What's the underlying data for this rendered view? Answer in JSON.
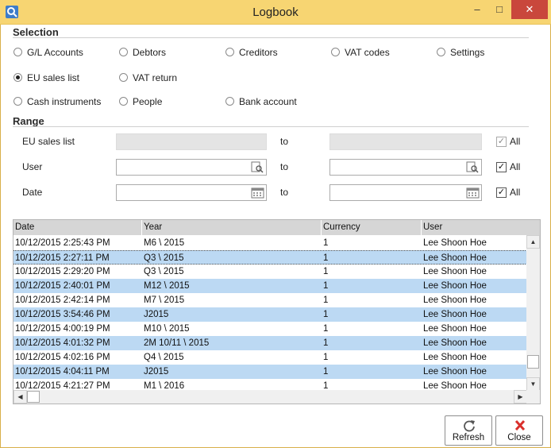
{
  "window": {
    "title": "Logbook",
    "minimize_glyph": "‒",
    "maximize_glyph": "□",
    "close_glyph": "✕"
  },
  "selection": {
    "heading": "Selection",
    "options": [
      {
        "label": "G/L Accounts",
        "selected": false
      },
      {
        "label": "Debtors",
        "selected": false
      },
      {
        "label": "Creditors",
        "selected": false
      },
      {
        "label": "VAT codes",
        "selected": false
      },
      {
        "label": "Settings",
        "selected": false
      },
      {
        "label": "EU sales list",
        "selected": true
      },
      {
        "label": "VAT return",
        "selected": false
      },
      {
        "label": "Cash instruments",
        "selected": false
      },
      {
        "label": "People",
        "selected": false
      },
      {
        "label": "Bank account",
        "selected": false
      }
    ]
  },
  "range": {
    "heading": "Range",
    "to_label": "to",
    "rows": [
      {
        "label": "EU sales list",
        "from_value": "",
        "to_value": "",
        "enabled": false,
        "all_label": "All",
        "all_checked": true,
        "icon": "none"
      },
      {
        "label": "User",
        "from_value": "",
        "to_value": "",
        "enabled": true,
        "all_label": "All",
        "all_checked": true,
        "icon": "lookup-icon"
      },
      {
        "label": "Date",
        "from_value": "",
        "to_value": "",
        "enabled": true,
        "all_label": "All",
        "all_checked": true,
        "icon": "calendar-icon"
      }
    ]
  },
  "grid": {
    "columns": [
      "Date",
      "Year",
      "Currency",
      "User"
    ],
    "rows": [
      {
        "date": "10/12/2015 2:25:43 PM",
        "year": "M6 \\ 2015",
        "currency": "1",
        "user": "Lee Shoon Hoe",
        "selected": false
      },
      {
        "date": "10/12/2015 2:27:11 PM",
        "year": "Q3 \\ 2015",
        "currency": "1",
        "user": "Lee Shoon Hoe",
        "selected": true
      },
      {
        "date": "10/12/2015 2:29:20 PM",
        "year": "Q3 \\ 2015",
        "currency": "1",
        "user": "Lee Shoon Hoe",
        "selected": false
      },
      {
        "date": "10/12/2015 2:40:01 PM",
        "year": "M12 \\ 2015",
        "currency": "1",
        "user": "Lee Shoon Hoe",
        "selected": true
      },
      {
        "date": "10/12/2015 2:42:14 PM",
        "year": "M7 \\ 2015",
        "currency": "1",
        "user": "Lee Shoon Hoe",
        "selected": false
      },
      {
        "date": "10/12/2015 3:54:46 PM",
        "year": "J2015",
        "currency": "1",
        "user": "Lee Shoon Hoe",
        "selected": true
      },
      {
        "date": "10/12/2015 4:00:19 PM",
        "year": "M10 \\ 2015",
        "currency": "1",
        "user": "Lee Shoon Hoe",
        "selected": false
      },
      {
        "date": "10/12/2015 4:01:32 PM",
        "year": "2M 10/11 \\ 2015",
        "currency": "1",
        "user": "Lee Shoon Hoe",
        "selected": true
      },
      {
        "date": "10/12/2015 4:02:16 PM",
        "year": "Q4 \\ 2015",
        "currency": "1",
        "user": "Lee Shoon Hoe",
        "selected": false
      },
      {
        "date": "10/12/2015 4:04:11 PM",
        "year": "J2015",
        "currency": "1",
        "user": "Lee Shoon Hoe",
        "selected": true
      },
      {
        "date": "10/12/2015 4:21:27 PM",
        "year": "M1 \\ 2016",
        "currency": "1",
        "user": "Lee Shoon Hoe",
        "selected": false
      }
    ]
  },
  "buttons": {
    "refresh": {
      "label": "Refresh",
      "icon": "refresh-icon"
    },
    "close": {
      "label": "Close",
      "icon": "close-x-icon"
    }
  },
  "colors": {
    "titlebar": "#f7d572",
    "close_button": "#c9473c",
    "row_highlight": "#bcd9f3",
    "close_icon": "#d9302c"
  }
}
